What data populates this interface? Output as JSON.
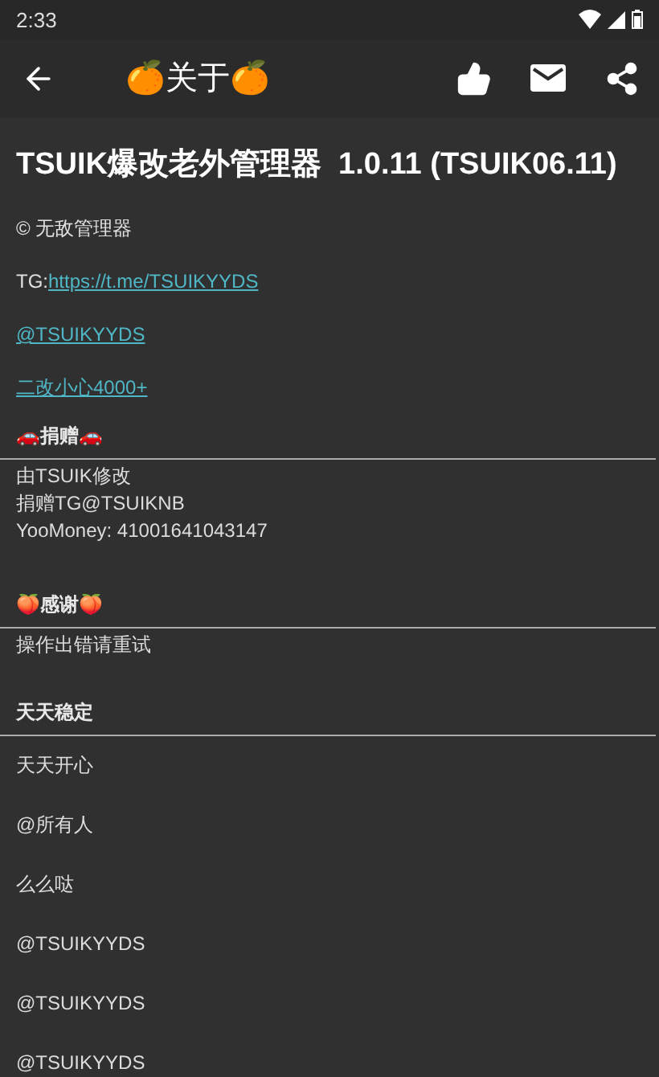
{
  "status_bar": {
    "time": "2:33"
  },
  "toolbar": {
    "title": "🍊关于🍊"
  },
  "app_title": "TSUIK爆改老外管理器  1.0.11 (TSUIK06.11)",
  "intro": [
    {
      "kind": "text",
      "text": "© 无敌管理器"
    },
    {
      "kind": "prefixed_link",
      "prefix": "TG:",
      "link": "https://t.me/TSUIKYYDS"
    },
    {
      "kind": "link",
      "link": "@TSUIKYYDS"
    },
    {
      "kind": "link",
      "link": "二改小心4000+"
    }
  ],
  "sections": [
    {
      "header": "🚗捐赠🚗",
      "kind": "compact",
      "lines": [
        "由TSUIK修改",
        "捐赠TG@TSUIKNB",
        "YooMoney: 41001641043147"
      ]
    },
    {
      "header": "🍑感谢🍑",
      "kind": "compact",
      "lines": [
        "操作出错请重试"
      ]
    },
    {
      "header": "天天稳定",
      "kind": "spaced",
      "lines": [
        "天天开心",
        "@所有人",
        "么么哒",
        "@TSUIKYYDS",
        "@TSUIKYYDS",
        "@TSUIKYYDS"
      ]
    }
  ]
}
